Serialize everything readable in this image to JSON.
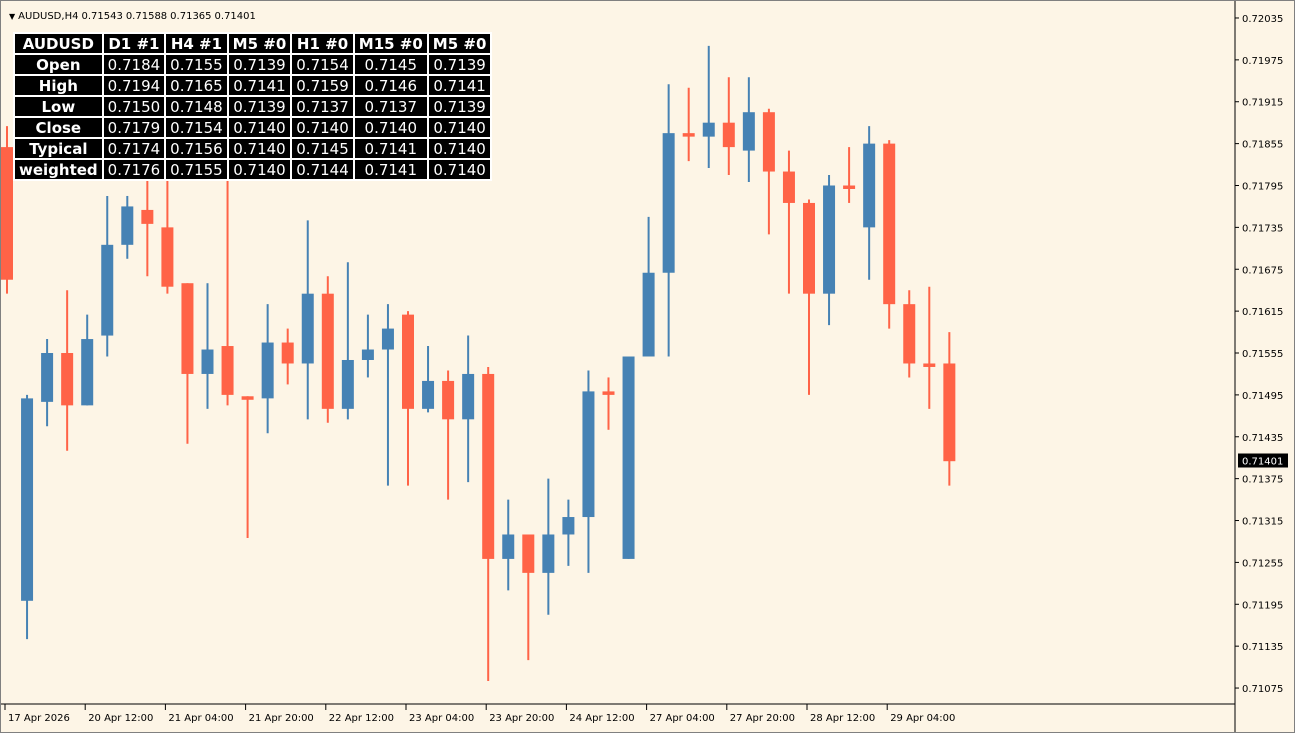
{
  "header": {
    "symbol_timeframe": "AUDUSD,H4",
    "open": "0.71543",
    "high": "0.71588",
    "low": "0.71365",
    "close": "0.71401"
  },
  "colors": {
    "background": "#fdf5e6",
    "bull": "#4682b4",
    "bear": "#ff6347",
    "price_tag": "#000000"
  },
  "table": {
    "headers": [
      "AUDUSD",
      "D1 #1",
      "H4 #1",
      "M5 #0",
      "H1 #0",
      "M15 #0",
      "M5 #0"
    ],
    "rows": [
      {
        "label": "Open",
        "values": [
          "0.7184",
          "0.7155",
          "0.7139",
          "0.7154",
          "0.7145",
          "0.7139"
        ]
      },
      {
        "label": "High",
        "values": [
          "0.7194",
          "0.7165",
          "0.7141",
          "0.7159",
          "0.7146",
          "0.7141"
        ]
      },
      {
        "label": "Low",
        "values": [
          "0.7150",
          "0.7148",
          "0.7139",
          "0.7137",
          "0.7137",
          "0.7139"
        ]
      },
      {
        "label": "Close",
        "values": [
          "0.7179",
          "0.7154",
          "0.7140",
          "0.7140",
          "0.7140",
          "0.7140"
        ]
      },
      {
        "label": "Typical",
        "values": [
          "0.7174",
          "0.7156",
          "0.7140",
          "0.7145",
          "0.7141",
          "0.7140"
        ]
      },
      {
        "label": "weighted",
        "values": [
          "0.7176",
          "0.7155",
          "0.7140",
          "0.7144",
          "0.7141",
          "0.7140"
        ]
      }
    ]
  },
  "chart_data": {
    "type": "candlestick",
    "ylim": [
      0.71055,
      0.72045
    ],
    "current_price": "0.71401",
    "yticks": [
      "0.72035",
      "0.71975",
      "0.71915",
      "0.71855",
      "0.71795",
      "0.71735",
      "0.71675",
      "0.71615",
      "0.71555",
      "0.71495",
      "0.71435",
      "0.71375",
      "0.71315",
      "0.71255",
      "0.71195",
      "0.71135",
      "0.71075"
    ],
    "xticks": [
      {
        "index": 0,
        "label": "17 Apr 2026"
      },
      {
        "index": 4,
        "label": "20 Apr 12:00"
      },
      {
        "index": 8,
        "label": "21 Apr 04:00"
      },
      {
        "index": 12,
        "label": "21 Apr 20:00"
      },
      {
        "index": 16,
        "label": "22 Apr 12:00"
      },
      {
        "index": 20,
        "label": "23 Apr 04:00"
      },
      {
        "index": 24,
        "label": "23 Apr 20:00"
      },
      {
        "index": 28,
        "label": "24 Apr 12:00"
      },
      {
        "index": 32,
        "label": "27 Apr 04:00"
      },
      {
        "index": 36,
        "label": "27 Apr 20:00"
      },
      {
        "index": 40,
        "label": "28 Apr 12:00"
      },
      {
        "index": 44,
        "label": "29 Apr 04:00"
      }
    ],
    "candles": [
      {
        "o": 0.7185,
        "h": 0.7188,
        "l": 0.7164,
        "c": 0.7166
      },
      {
        "o": 0.712,
        "h": 0.71495,
        "l": 0.71145,
        "c": 0.7149
      },
      {
        "o": 0.71485,
        "h": 0.71575,
        "l": 0.7145,
        "c": 0.71555
      },
      {
        "o": 0.71555,
        "h": 0.71645,
        "l": 0.71415,
        "c": 0.7148
      },
      {
        "o": 0.7148,
        "h": 0.7161,
        "l": 0.7148,
        "c": 0.71575
      },
      {
        "o": 0.7158,
        "h": 0.7178,
        "l": 0.7155,
        "c": 0.7171
      },
      {
        "o": 0.7171,
        "h": 0.7178,
        "l": 0.7169,
        "c": 0.71765
      },
      {
        "o": 0.7176,
        "h": 0.7181,
        "l": 0.71665,
        "c": 0.7174
      },
      {
        "o": 0.71735,
        "h": 0.7181,
        "l": 0.7164,
        "c": 0.7165
      },
      {
        "o": 0.71655,
        "h": 0.7165,
        "l": 0.71425,
        "c": 0.71525
      },
      {
        "o": 0.71525,
        "h": 0.71655,
        "l": 0.71475,
        "c": 0.7156
      },
      {
        "o": 0.71565,
        "h": 0.7185,
        "l": 0.7148,
        "c": 0.71495
      },
      {
        "o": 0.71493,
        "h": 0.71493,
        "l": 0.7129,
        "c": 0.71488
      },
      {
        "o": 0.7149,
        "h": 0.71625,
        "l": 0.7144,
        "c": 0.7157
      },
      {
        "o": 0.7157,
        "h": 0.7159,
        "l": 0.7151,
        "c": 0.7154
      },
      {
        "o": 0.7154,
        "h": 0.71745,
        "l": 0.7146,
        "c": 0.7164
      },
      {
        "o": 0.7164,
        "h": 0.71665,
        "l": 0.71455,
        "c": 0.71475
      },
      {
        "o": 0.71475,
        "h": 0.71685,
        "l": 0.7146,
        "c": 0.71545
      },
      {
        "o": 0.71545,
        "h": 0.7161,
        "l": 0.7152,
        "c": 0.7156
      },
      {
        "o": 0.7156,
        "h": 0.71625,
        "l": 0.71365,
        "c": 0.7159
      },
      {
        "o": 0.7161,
        "h": 0.71615,
        "l": 0.71365,
        "c": 0.71475
      },
      {
        "o": 0.71475,
        "h": 0.71565,
        "l": 0.7147,
        "c": 0.71515
      },
      {
        "o": 0.71515,
        "h": 0.7153,
        "l": 0.71345,
        "c": 0.7146
      },
      {
        "o": 0.7146,
        "h": 0.7158,
        "l": 0.7137,
        "c": 0.71525
      },
      {
        "o": 0.71525,
        "h": 0.71535,
        "l": 0.71085,
        "c": 0.7126
      },
      {
        "o": 0.7126,
        "h": 0.71345,
        "l": 0.71215,
        "c": 0.71295
      },
      {
        "o": 0.71295,
        "h": 0.71295,
        "l": 0.71115,
        "c": 0.7124
      },
      {
        "o": 0.7124,
        "h": 0.71375,
        "l": 0.7118,
        "c": 0.71295
      },
      {
        "o": 0.71295,
        "h": 0.71345,
        "l": 0.7125,
        "c": 0.7132
      },
      {
        "o": 0.7132,
        "h": 0.7153,
        "l": 0.7124,
        "c": 0.715
      },
      {
        "o": 0.715,
        "h": 0.7152,
        "l": 0.71445,
        "c": 0.71495
      },
      {
        "o": 0.7126,
        "h": 0.715,
        "l": 0.7126,
        "c": 0.7155
      },
      {
        "o": 0.7155,
        "h": 0.7175,
        "l": 0.7155,
        "c": 0.7167
      },
      {
        "o": 0.7167,
        "h": 0.7194,
        "l": 0.7155,
        "c": 0.7187
      },
      {
        "o": 0.7187,
        "h": 0.71935,
        "l": 0.7183,
        "c": 0.71865
      },
      {
        "o": 0.71865,
        "h": 0.71995,
        "l": 0.7182,
        "c": 0.71885
      },
      {
        "o": 0.71885,
        "h": 0.7195,
        "l": 0.7181,
        "c": 0.7185
      },
      {
        "o": 0.71845,
        "h": 0.7195,
        "l": 0.718,
        "c": 0.719
      },
      {
        "o": 0.719,
        "h": 0.71905,
        "l": 0.71725,
        "c": 0.71815
      },
      {
        "o": 0.71815,
        "h": 0.71845,
        "l": 0.7164,
        "c": 0.7177
      },
      {
        "o": 0.7177,
        "h": 0.71775,
        "l": 0.71495,
        "c": 0.7164
      },
      {
        "o": 0.7164,
        "h": 0.7181,
        "l": 0.71595,
        "c": 0.71795
      },
      {
        "o": 0.71795,
        "h": 0.7185,
        "l": 0.7177,
        "c": 0.7179
      },
      {
        "o": 0.71735,
        "h": 0.7188,
        "l": 0.7166,
        "c": 0.71855
      },
      {
        "o": 0.71855,
        "h": 0.7186,
        "l": 0.7159,
        "c": 0.71625
      },
      {
        "o": 0.71625,
        "h": 0.71645,
        "l": 0.7152,
        "c": 0.7154
      },
      {
        "o": 0.7154,
        "h": 0.7165,
        "l": 0.71475,
        "c": 0.71535
      },
      {
        "o": 0.7154,
        "h": 0.71585,
        "l": 0.71365,
        "c": 0.714
      }
    ]
  }
}
